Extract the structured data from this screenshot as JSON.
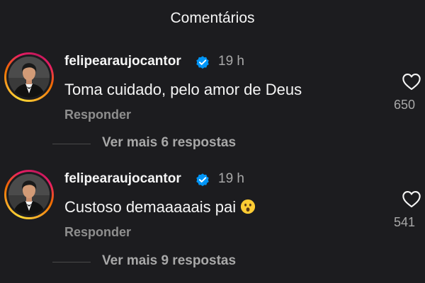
{
  "header": {
    "title": "Comentários"
  },
  "comments": [
    {
      "username": "felipearaujocantor",
      "time": "19 h",
      "text": "Toma cuidado, pelo amor de Deus",
      "reply_label": "Responder",
      "likes": "650",
      "avatar_icon": "profile-photo",
      "more_replies": "Ver mais 6 respostas"
    },
    {
      "username": "felipearaujocantor",
      "time": "19 h",
      "text": "Custoso demaaaaais pai",
      "emoji": "astonished-face-emoji",
      "reply_label": "Responder",
      "likes": "541",
      "avatar_icon": "profile-photo",
      "more_replies": "Ver mais 9 respostas"
    }
  ],
  "colors": {
    "background": "#1c1c1f",
    "verified_badge": "#0095f6",
    "muted_text": "#a8a8a8"
  }
}
